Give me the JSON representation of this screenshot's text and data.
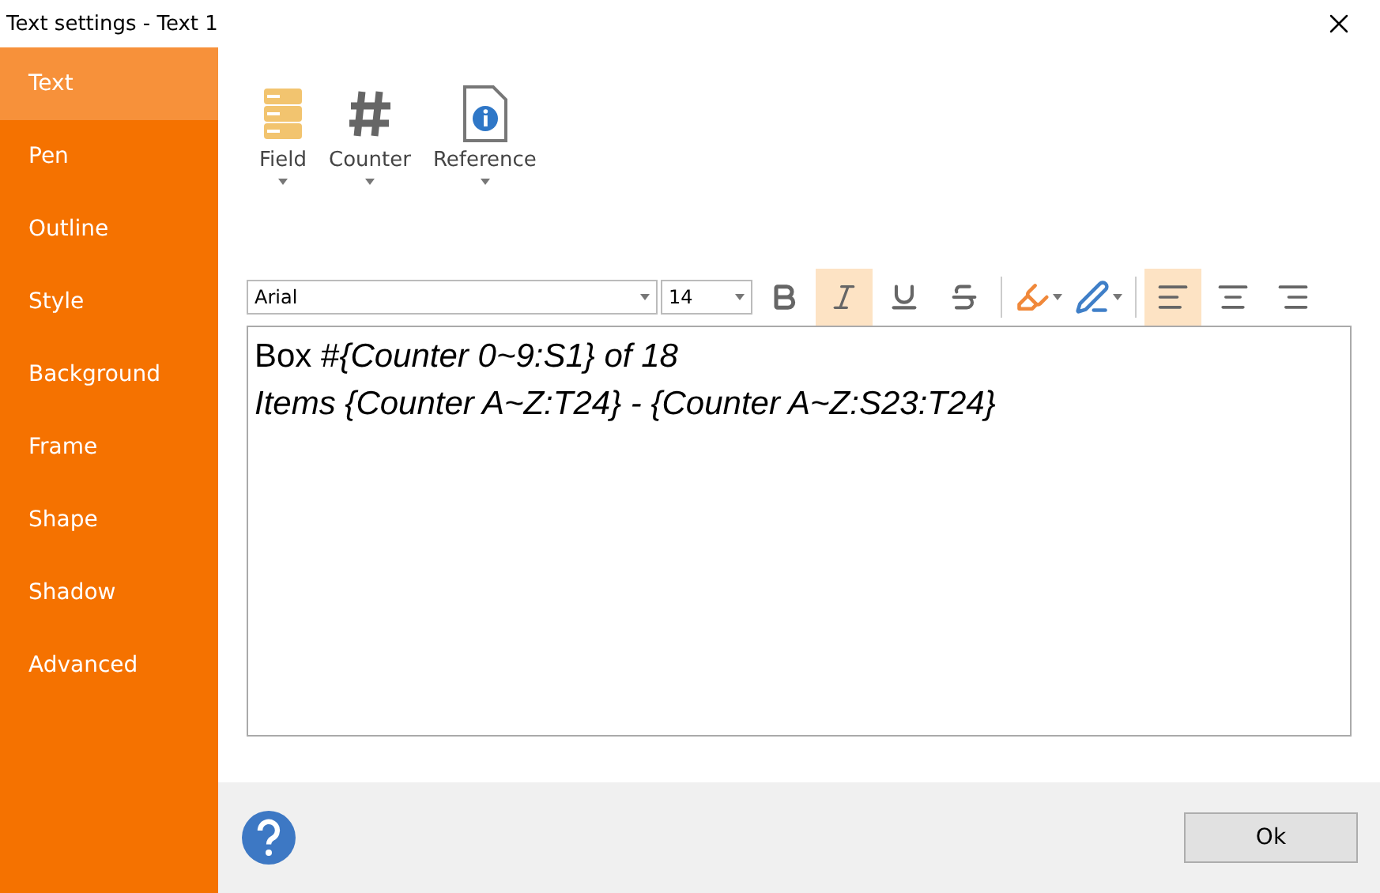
{
  "window": {
    "title": "Text settings - Text 1"
  },
  "sidebar": {
    "items": [
      {
        "label": "Text",
        "selected": true
      },
      {
        "label": "Pen",
        "selected": false
      },
      {
        "label": "Outline",
        "selected": false
      },
      {
        "label": "Style",
        "selected": false
      },
      {
        "label": "Background",
        "selected": false
      },
      {
        "label": "Frame",
        "selected": false
      },
      {
        "label": "Shape",
        "selected": false
      },
      {
        "label": "Shadow",
        "selected": false
      },
      {
        "label": "Advanced",
        "selected": false
      }
    ]
  },
  "insert_toolbar": [
    {
      "kind": "field",
      "label": "Field"
    },
    {
      "kind": "counter",
      "label": "Counter"
    },
    {
      "kind": "reference",
      "label": "Reference"
    }
  ],
  "format_toolbar": {
    "font": "Arial",
    "size": "14",
    "buttons": [
      {
        "kind": "bold",
        "selected": false
      },
      {
        "kind": "italic",
        "selected": true
      },
      {
        "kind": "underline",
        "selected": false
      },
      {
        "kind": "strike",
        "selected": false
      },
      {
        "kind": "highlight",
        "selected": false
      },
      {
        "kind": "pen",
        "selected": false
      },
      {
        "kind": "align-left",
        "selected": true
      },
      {
        "kind": "align-center",
        "selected": false
      },
      {
        "kind": "align-right",
        "selected": false
      }
    ]
  },
  "editor": {
    "lines": [
      {
        "text": "Box #*{Counter 0~9:S1} of 18*",
        "italic": false
      },
      {
        "text": "Items {Counter A~Z:T24} - {Counter A~Z:S23:T24}",
        "italic": true
      }
    ]
  },
  "footer": {
    "ok": "Ok"
  }
}
